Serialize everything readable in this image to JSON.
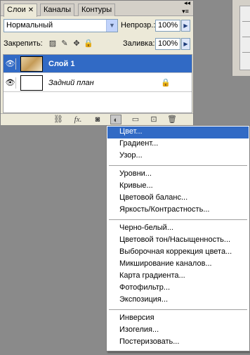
{
  "panel": {
    "tabs": [
      {
        "label": "Слои",
        "close": "✕"
      },
      {
        "label": "Каналы"
      },
      {
        "label": "Контуры"
      }
    ],
    "menu_icon": "▾≡",
    "collapse_icon": "◂◂"
  },
  "blend": {
    "mode": "Нормальный",
    "arrow": "▼"
  },
  "opacity": {
    "label": "Непрозр.:",
    "value": "100%",
    "arrow": "▶"
  },
  "lock": {
    "label": "Закрепить:"
  },
  "fill": {
    "label": "Заливка:",
    "value": "100%",
    "arrow": "▶"
  },
  "layers": [
    {
      "name": "Слой 1",
      "selected": true
    },
    {
      "name": "Задний план",
      "selected": false
    }
  ],
  "icons": {
    "eye": "👁",
    "lock": "🔒",
    "lock_transparent": "▨",
    "lock_paint": "✎",
    "lock_move": "✥",
    "lock_all": "🔒",
    "link": "⛓",
    "fx": "fx.",
    "mask": "◙",
    "adjust": "◐",
    "group": "▭",
    "new_layer": "⊡",
    "trash": "🗑"
  },
  "menu": {
    "group1": [
      "Цвет...",
      "Градиент...",
      "Узор..."
    ],
    "group2": [
      "Уровни...",
      "Кривые...",
      "Цветовой баланс...",
      "Яркость/Контрастность..."
    ],
    "group3": [
      "Черно-белый...",
      "Цветовой тон/Насыщенность...",
      "Выборочная коррекция цвета...",
      "Микширование каналов...",
      "Карта градиента...",
      "Фотофильтр...",
      "Экспозиция..."
    ],
    "group4": [
      "Инверсия",
      "Изогелия...",
      "Постеризовать..."
    ]
  }
}
